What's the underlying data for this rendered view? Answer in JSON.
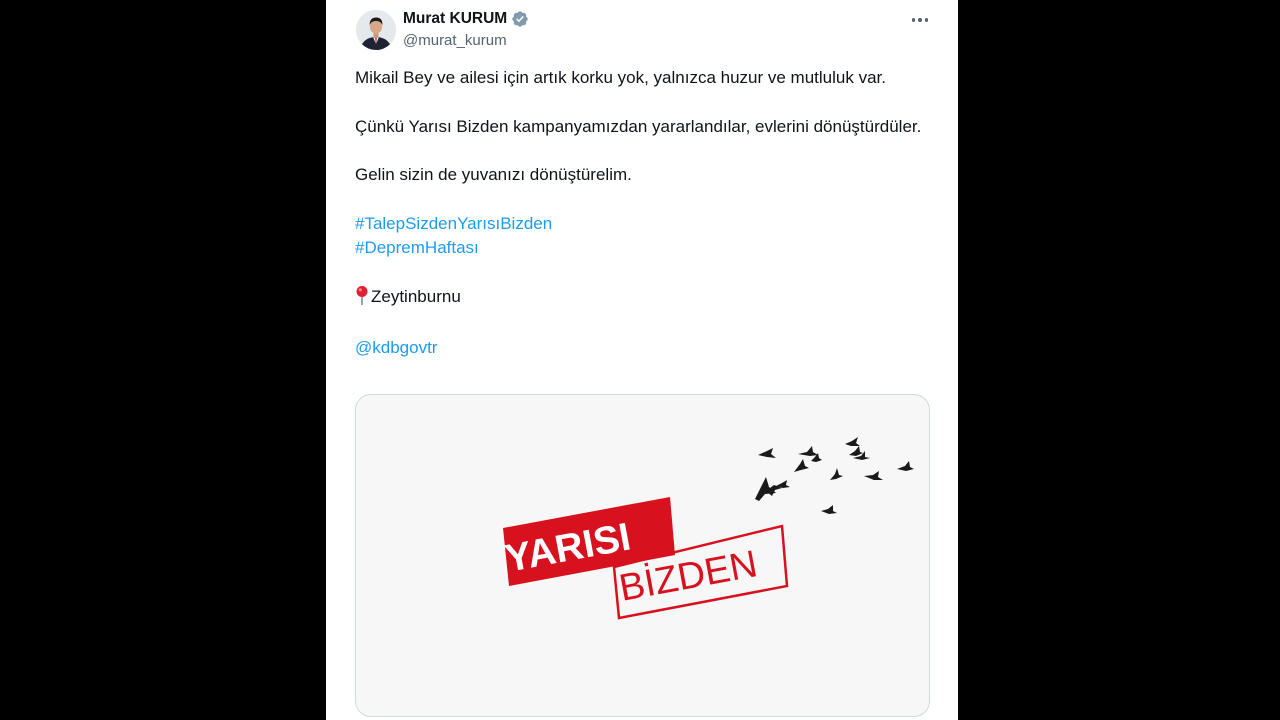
{
  "tweet": {
    "author": {
      "display_name": "Murat KURUM",
      "handle": "@murat_kurum",
      "verified": true
    },
    "paragraphs": [
      "Mikail Bey ve ailesi için artık korku yok, yalnızca huzur ve mutluluk var.",
      "Çünkü Yarısı Bizden kampanyamızdan yararlandılar, evlerini dönüştürdüler.",
      "Gelin sizin de yuvanızı dönüştürelim."
    ],
    "hashtags": [
      "#TalepSizdenYarısıBizden",
      "#DepremHaftası"
    ],
    "location": "Zeytinburnu",
    "mention": "@kdbgovtr",
    "media": {
      "line1": "YARISI",
      "line2": "BİZDEN",
      "brand_color": "#d7111e"
    },
    "icons": {
      "more": "more-options-icon",
      "verified": "verified-badge-icon",
      "location": "round-pushpin-icon"
    },
    "colors": {
      "link": "#1d9bf0",
      "text": "#0f1419",
      "secondary": "#536471"
    }
  }
}
